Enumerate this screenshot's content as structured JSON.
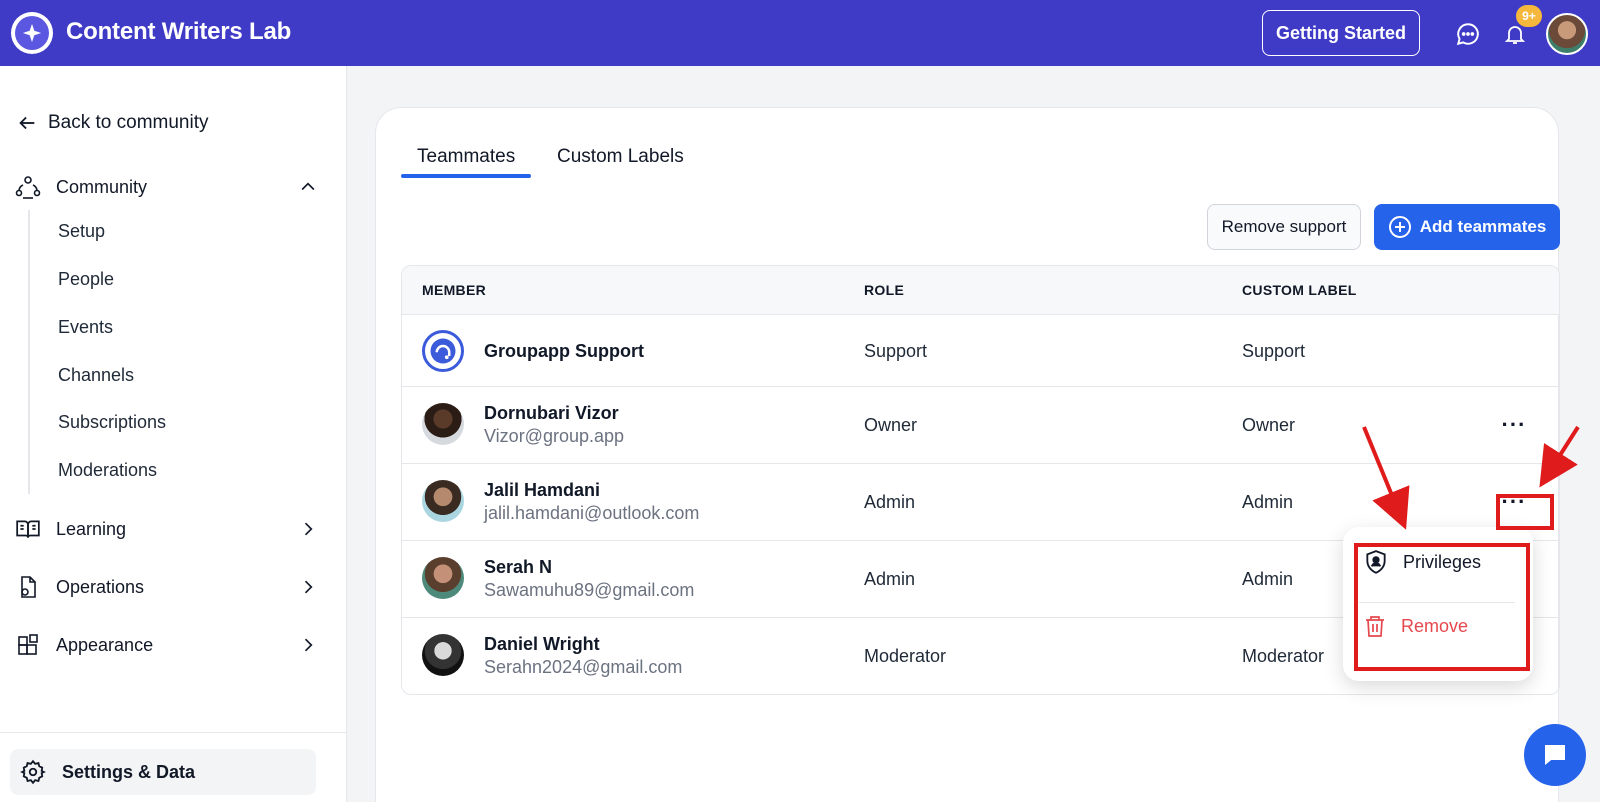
{
  "header": {
    "app_title": "Content Writers Lab",
    "getting_started_label": "Getting Started",
    "notification_badge": "9+",
    "colors": {
      "header_bg": "#3f3bc7",
      "badge": "#f5b83d"
    }
  },
  "sidebar": {
    "back_label": "Back to community",
    "community": {
      "label": "Community",
      "items": [
        {
          "label": "Setup"
        },
        {
          "label": "People"
        },
        {
          "label": "Events"
        },
        {
          "label": "Channels"
        },
        {
          "label": "Subscriptions"
        },
        {
          "label": "Moderations"
        }
      ]
    },
    "groups": [
      {
        "label": "Learning",
        "icon": "book-icon"
      },
      {
        "label": "Operations",
        "icon": "document-icon"
      },
      {
        "label": "Appearance",
        "icon": "blocks-icon"
      }
    ],
    "settings_label": "Settings & Data"
  },
  "main": {
    "tabs": [
      {
        "label": "Teammates",
        "active": true
      },
      {
        "label": "Custom Labels",
        "active": false
      }
    ],
    "remove_support_label": "Remove support",
    "add_teammates_label": "Add teammates",
    "table": {
      "headers": {
        "member": "MEMBER",
        "role": "ROLE",
        "custom_label": "CUSTOM LABEL"
      },
      "rows": [
        {
          "name": "Groupapp Support",
          "email": "",
          "role": "Support",
          "custom_label": "Support"
        },
        {
          "name": "Dornubari Vizor",
          "email": "Vizor@group.app",
          "role": "Owner",
          "custom_label": "Owner"
        },
        {
          "name": "Jalil Hamdani",
          "email": "jalil.hamdani@outlook.com",
          "role": "Admin",
          "custom_label": "Admin"
        },
        {
          "name": "Serah N",
          "email": "Sawamuhu89@gmail.com",
          "role": "Admin",
          "custom_label": "Admin"
        },
        {
          "name": "Daniel Wright",
          "email": "Serahn2024@gmail.com",
          "role": "Moderator",
          "custom_label": "Moderator"
        }
      ]
    },
    "row_menu": {
      "privileges_label": "Privileges",
      "remove_label": "Remove"
    }
  },
  "accent_color": "#2563eb",
  "danger_color": "#e5484d",
  "annotation_color": "#e01b1b"
}
